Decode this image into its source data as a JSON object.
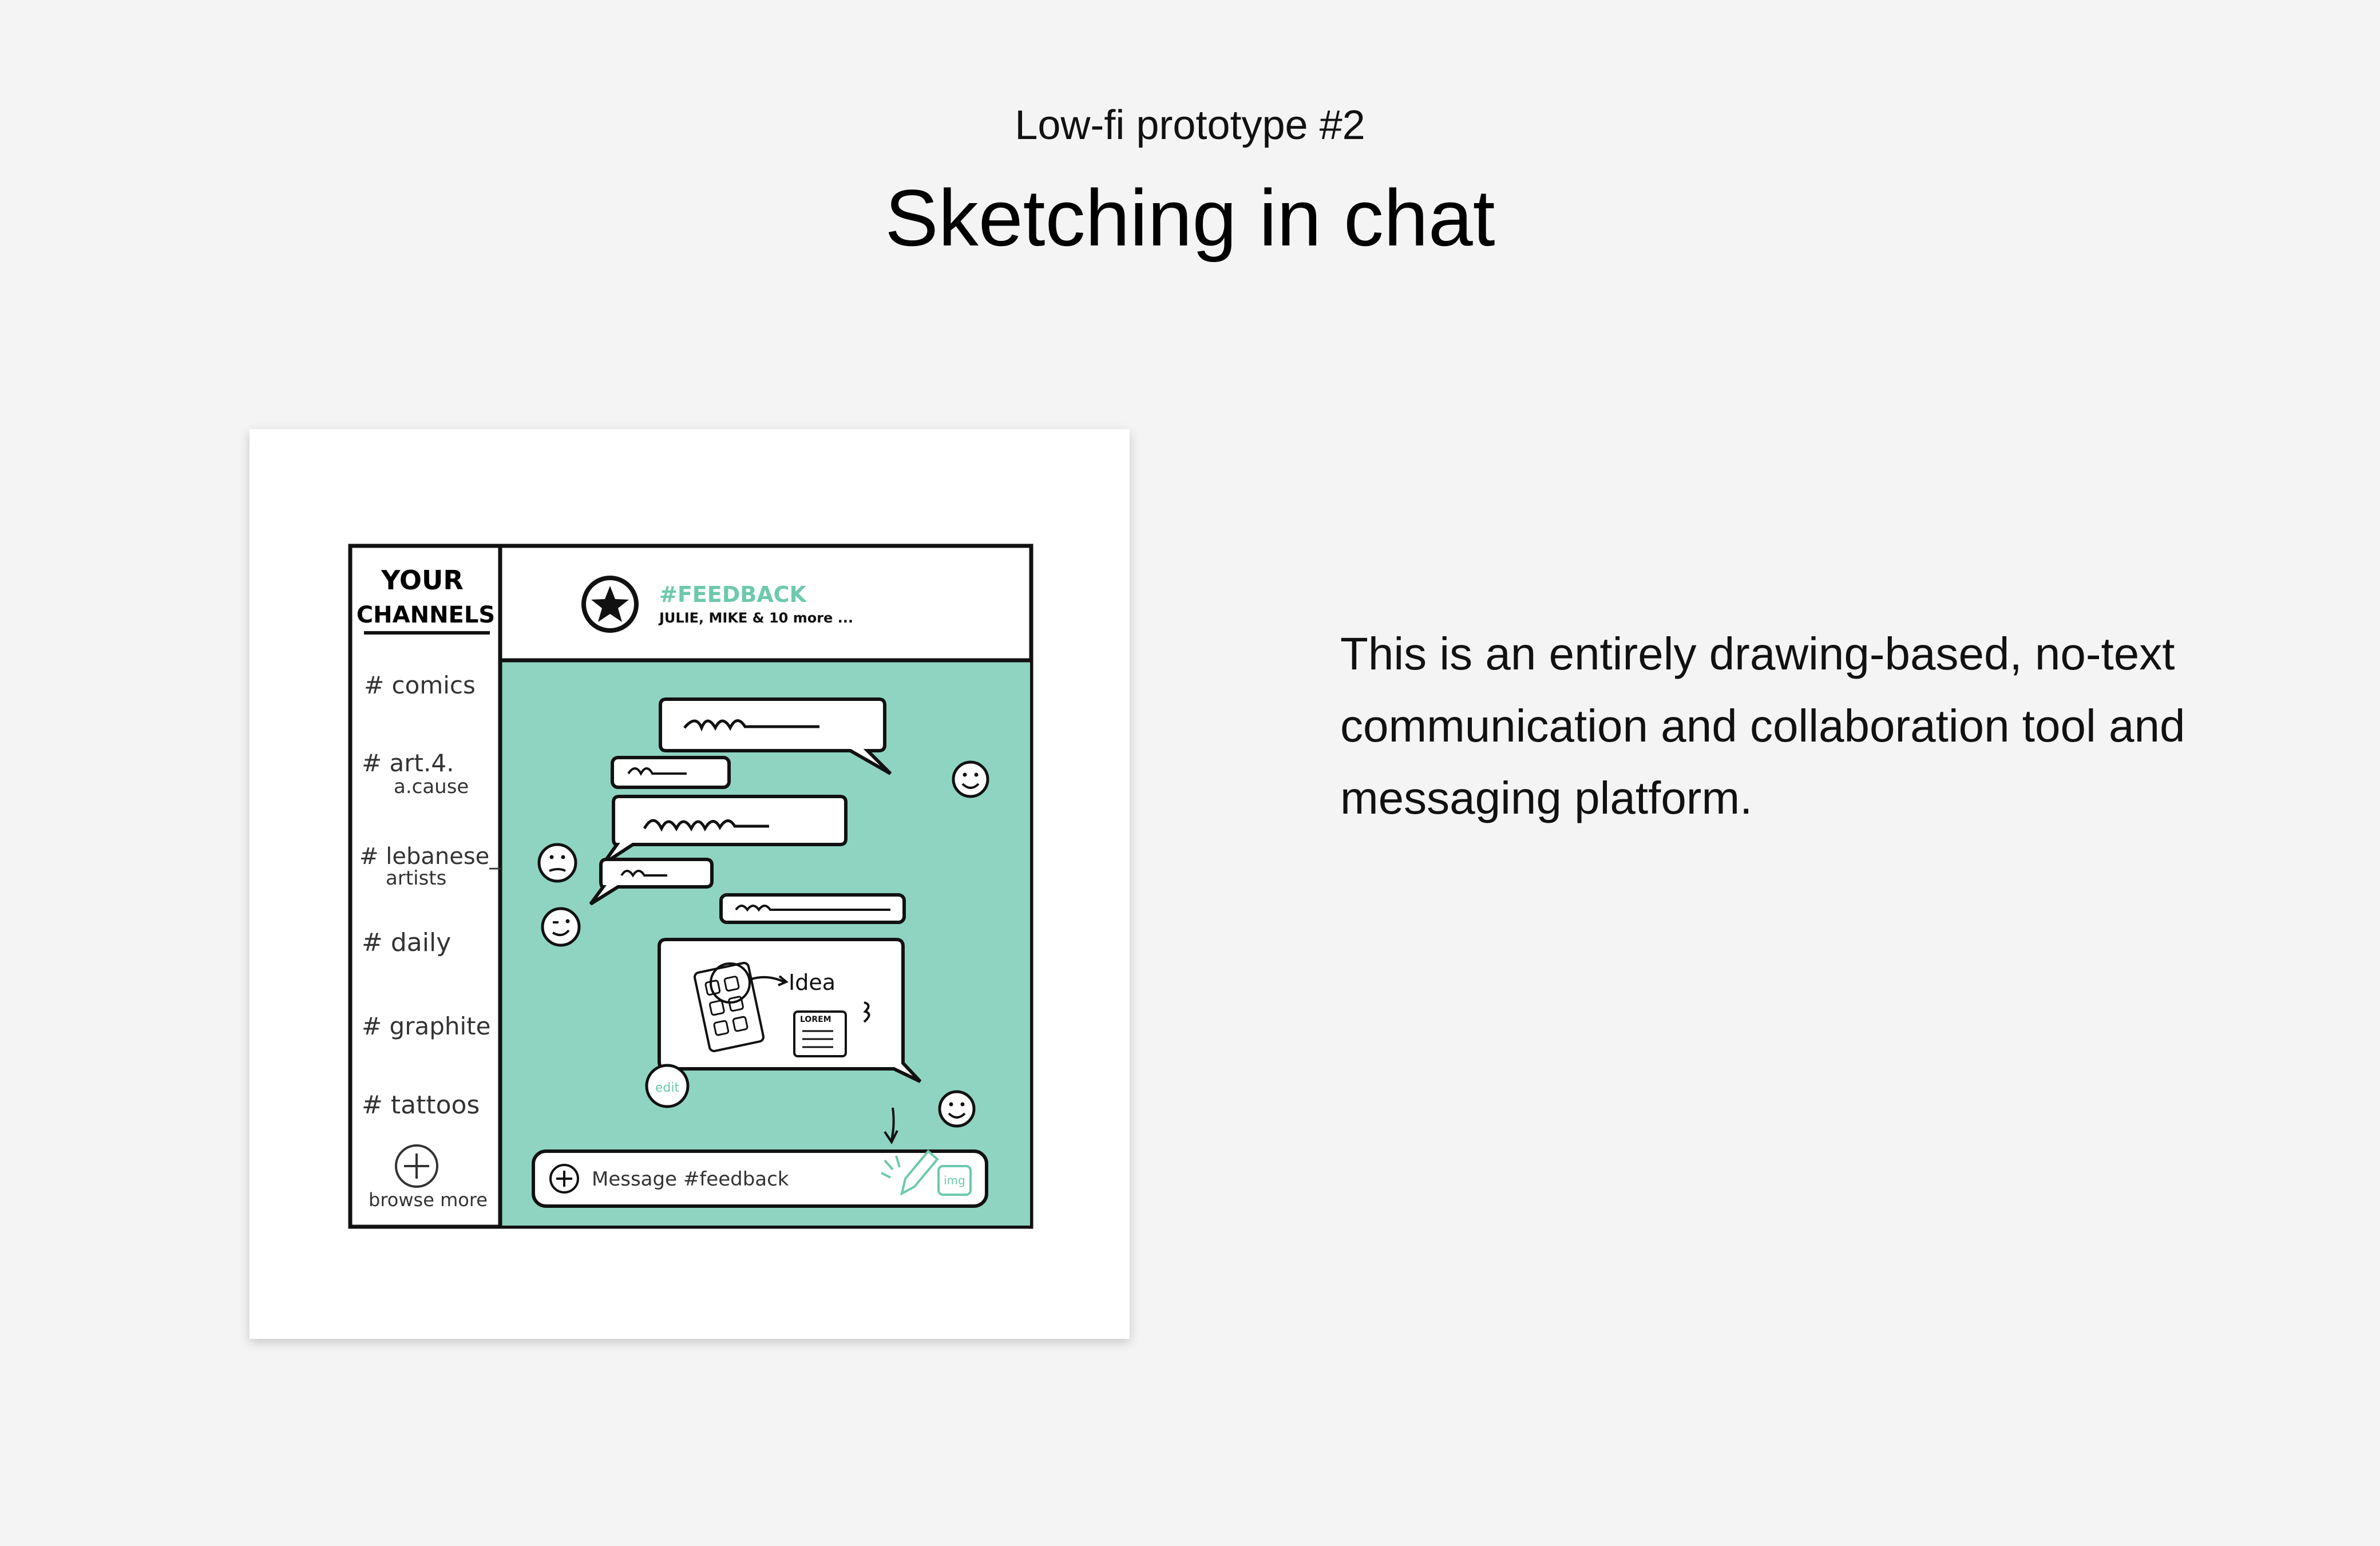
{
  "header": {
    "subtitle": "Low-fi prototype #2",
    "title": "Sketching in chat"
  },
  "description": "This is an entirely drawing-based, no-text communication and collaboration tool and messaging platform.",
  "sketch": {
    "sidebar_title_line1": "YOUR",
    "sidebar_title_line2": "CHANNELS",
    "channels": [
      {
        "line1": "# comics",
        "line2": ""
      },
      {
        "line1": "# art.4.",
        "line2": "a.cause"
      },
      {
        "line1": "# lebanese_",
        "line2": "artists"
      },
      {
        "line1": "# daily",
        "line2": ""
      },
      {
        "line1": "# graphite",
        "line2": ""
      },
      {
        "line1": "# tattoos",
        "line2": ""
      }
    ],
    "browse_more": "browse more",
    "channel_name": "#FEEDBACK",
    "members": "JULIE, MIKE & 10 more ...",
    "idea_label": "Idea",
    "lorem_label": "LOREM",
    "edit_label": "edit",
    "message_placeholder": "Message #feedback",
    "img_label": "img",
    "accent_color": "#8fd4c1",
    "icons": [
      "star-icon",
      "plus-icon",
      "pencil-icon",
      "image-icon",
      "smiley-icon"
    ]
  }
}
